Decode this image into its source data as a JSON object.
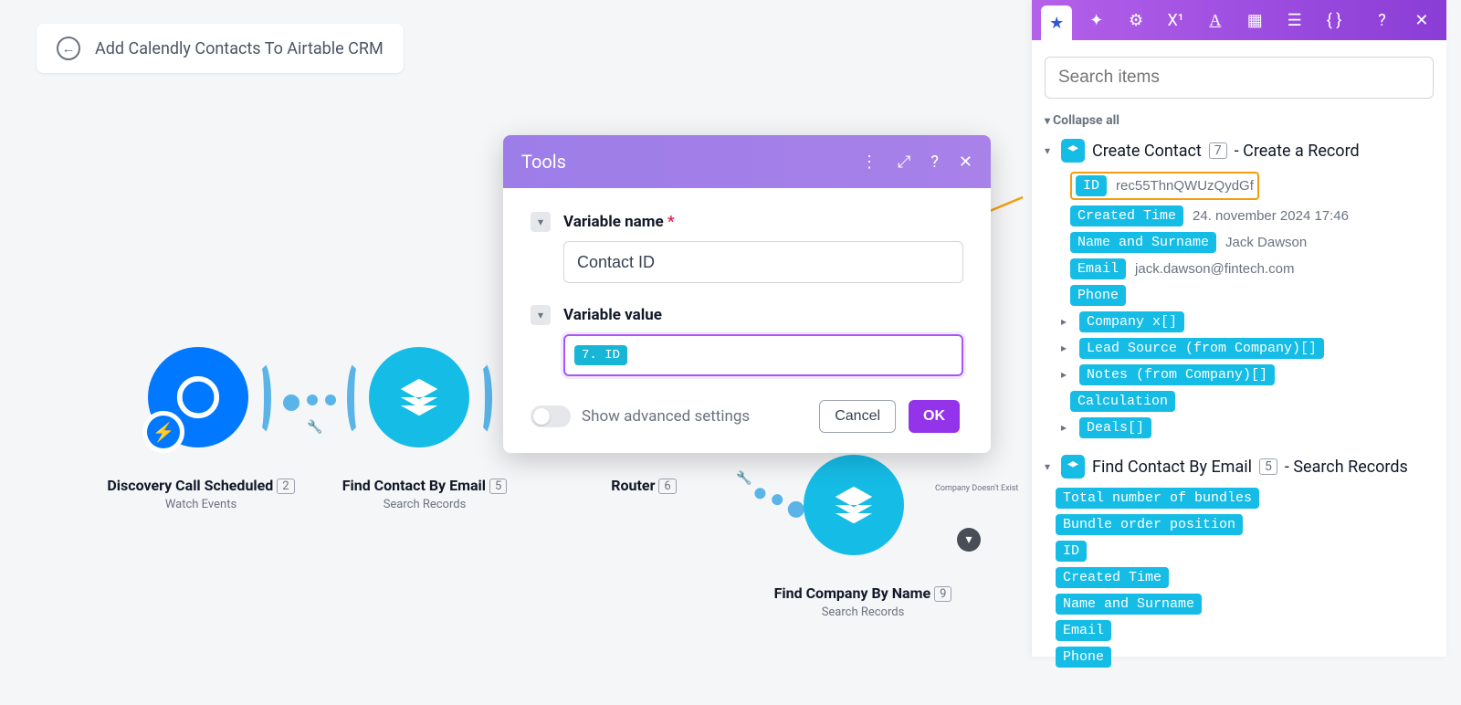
{
  "breadcrumb": {
    "title": "Add Calendly Contacts To Airtable CRM"
  },
  "nodes": {
    "n1": {
      "title": "Discovery Call Scheduled",
      "num": "2",
      "sub": "Watch Events"
    },
    "n2": {
      "title": "Find Contact By Email",
      "num": "5",
      "sub": "Search Records"
    },
    "router": {
      "title": "Router",
      "num": "6"
    },
    "n4": {
      "title": "Find Company By Name",
      "num": "9",
      "sub": "Search Records"
    },
    "filter_label": "Company Doesn't Exist"
  },
  "modal": {
    "title": "Tools",
    "field_name_label": "Variable name",
    "field_name_value": "Contact ID",
    "field_value_label": "Variable value",
    "pill": "7. ID",
    "advanced": "Show advanced settings",
    "cancel": "Cancel",
    "ok": "OK"
  },
  "panel": {
    "search_placeholder": "Search items",
    "collapse": "Collapse all",
    "mod1": {
      "name": "Create Contact",
      "num": "7",
      "sub": "- Create a Record"
    },
    "mod1_items": {
      "id": {
        "tag": "ID",
        "val": "rec55ThnQWUzQydGf"
      },
      "created": {
        "tag": "Created Time",
        "val": "24. november 2024 17:46"
      },
      "name": {
        "tag": "Name and Surname",
        "val": "Jack Dawson"
      },
      "email": {
        "tag": "Email",
        "val": "jack.dawson@fintech.com"
      },
      "phone": {
        "tag": "Phone"
      },
      "company": {
        "tag": "Company x[]"
      },
      "lead": {
        "tag": "Lead Source (from Company)[]"
      },
      "notes": {
        "tag": "Notes (from Company)[]"
      },
      "calc": {
        "tag": "Calculation"
      },
      "deals": {
        "tag": "Deals[]"
      }
    },
    "mod2": {
      "name": "Find Contact By Email",
      "num": "5",
      "sub": "- Search Records"
    },
    "mod2_items": {
      "total": "Total number of bundles",
      "order": "Bundle order position",
      "id": "ID",
      "created": "Created Time",
      "name": "Name and Surname",
      "email": "Email",
      "phone": "Phone"
    }
  }
}
